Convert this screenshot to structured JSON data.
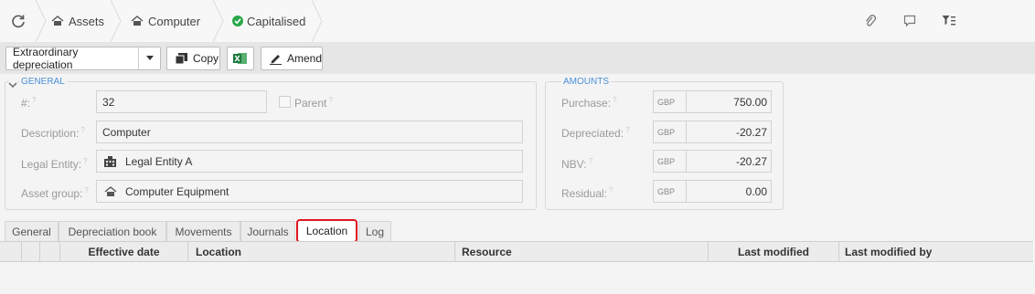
{
  "breadcrumb": {
    "items": [
      {
        "label": "Assets",
        "icon": "asset-icon"
      },
      {
        "label": "Computer",
        "icon": "asset-icon"
      },
      {
        "label": "Capitalised",
        "icon": "check-circle-icon"
      }
    ]
  },
  "toolbar": {
    "action_select": "Extraordinary depreciation",
    "copy_label": "Copy",
    "amend_label": "Amend"
  },
  "general": {
    "legend": "GENERAL",
    "number_label": "#:",
    "number_value": "32",
    "parent_label": "Parent",
    "description_label": "Description:",
    "description_value": "Computer",
    "legal_entity_label": "Legal Entity:",
    "legal_entity_value": "Legal Entity A",
    "asset_group_label": "Asset group:",
    "asset_group_value": "Computer Equipment",
    "help_mark": "?"
  },
  "amounts": {
    "legend": "AMOUNTS",
    "rows": [
      {
        "label": "Purchase:",
        "currency": "GBP",
        "value": "750.00"
      },
      {
        "label": "Depreciated:",
        "currency": "GBP",
        "value": "-20.27"
      },
      {
        "label": "NBV:",
        "currency": "GBP",
        "value": "-20.27"
      },
      {
        "label": "Residual:",
        "currency": "GBP",
        "value": "0.00"
      }
    ]
  },
  "tabs": [
    {
      "label": "General",
      "active": false
    },
    {
      "label": "Depreciation book",
      "active": false
    },
    {
      "label": "Movements",
      "active": false
    },
    {
      "label": "Journals",
      "active": false
    },
    {
      "label": "Location",
      "active": true
    },
    {
      "label": "Log",
      "active": false
    }
  ],
  "grid": {
    "columns": [
      "Effective date",
      "Location",
      "Resource",
      "Last modified",
      "Last modified by"
    ]
  },
  "colors": {
    "accent": "#4a90d9",
    "success": "#2aa84a",
    "highlight": "#e0141f",
    "excel": "#1e7a3c"
  }
}
